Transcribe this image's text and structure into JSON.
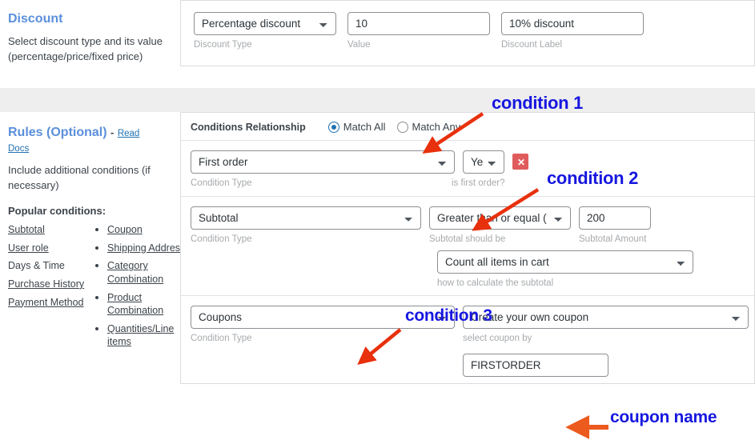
{
  "discount": {
    "title": "Discount",
    "description": "Select discount type and its value (percentage/price/fixed price)",
    "type_value": "Percentage discount",
    "type_helper": "Discount Type",
    "amount_value": "10",
    "amount_helper": "Value",
    "label_value": "10% discount",
    "label_helper": "Discount Label"
  },
  "rules": {
    "title": "Rules (Optional)",
    "dash": "-",
    "read_docs": "Read Docs",
    "description": "Include additional conditions (if necessary)",
    "popular_heading": "Popular conditions:",
    "plain_conditions": [
      "Subtotal",
      "User role",
      "Days & Time",
      "Purchase History",
      "Payment Method"
    ],
    "bullet_conditions": [
      "Coupon",
      "Shipping Address",
      "Category Combination",
      "Product Combination",
      "Quantities/Line items"
    ],
    "relationship_label": "Conditions Relationship",
    "match_all": "Match All",
    "match_any": "Match Any",
    "delete_glyph": "✕"
  },
  "conditions": [
    {
      "type_value": "First order",
      "type_helper": "Condition Type",
      "second_value": "Yes",
      "second_helper": "is first order?"
    },
    {
      "type_value": "Subtotal",
      "type_helper": "Condition Type",
      "operator_value": "Greater than or equal ( >= )",
      "operator_helper": "Subtotal should be",
      "amount_value": "200",
      "amount_helper": "Subtotal Amount",
      "calc_value": "Count all items in cart",
      "calc_helper": "how to calculate the subtotal"
    },
    {
      "type_value": "Coupons",
      "type_helper": "Condition Type",
      "second_value": "Create your own coupon",
      "second_helper": "select coupon by",
      "coupon_name": "FIRSTORDER"
    }
  ],
  "annotations": [
    {
      "text": "condition 1"
    },
    {
      "text": "condition 2"
    },
    {
      "text": "condition 3"
    },
    {
      "text": "coupon name"
    }
  ],
  "colors": {
    "annotation_text": "#1717e0",
    "arrow_red": "#e8300c",
    "arrow_orange": "#ec5a1e",
    "heading_blue": "#5a8fdb",
    "link_blue": "#2271b1",
    "delete_red": "#e05c5c"
  }
}
